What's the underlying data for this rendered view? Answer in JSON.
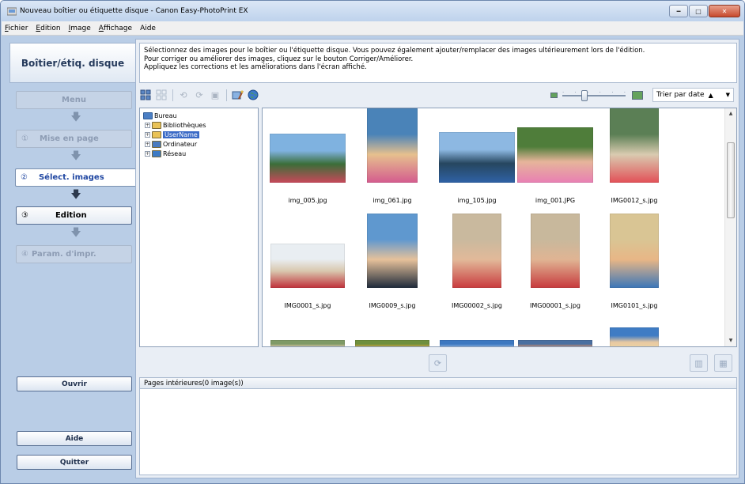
{
  "window": {
    "title": "Nouveau boîtier ou étiquette disque - Canon Easy-PhotoPrint EX"
  },
  "menu": [
    {
      "pre": "",
      "key": "F",
      "post": "ichier"
    },
    {
      "pre": "",
      "key": "E",
      "post": "dition"
    },
    {
      "pre": "",
      "key": "I",
      "post": "mage"
    },
    {
      "pre": "",
      "key": "A",
      "post": "ffichage"
    },
    {
      "pre": "",
      "key": "",
      "post": "Aide"
    }
  ],
  "sidebar": {
    "mode_title": "Boîtier/étiq. disque",
    "menu_step": "Menu",
    "steps": [
      {
        "num": "①",
        "label": "Mise en page",
        "state": "disabled"
      },
      {
        "num": "②",
        "label": "Sélect. images",
        "state": "active"
      },
      {
        "num": "③",
        "label": "Edition",
        "state": "enabled"
      },
      {
        "num": "④",
        "label": "Param. d'impr.",
        "state": "disabled"
      }
    ],
    "open_button": "Ouvrir",
    "help_button": "Aide",
    "quit_button": "Quitter"
  },
  "guide": {
    "lines": [
      "Sélectionnez des images pour le boîtier ou l'étiquette disque. Vous pouvez également ajouter/remplacer des images ultérieurement lors de l'édition.",
      "Pour corriger ou améliorer des images, cliquez sur le bouton Corriger/Améliorer.",
      "Appliquez les corrections et les améliorations dans l'écran affiché."
    ]
  },
  "toolbar": {
    "sort_label": "Trier par date",
    "sort_chevron": "▲"
  },
  "tree": {
    "root": "Bureau",
    "items": [
      {
        "label": "Bibliothèques",
        "color": "#e9c257"
      },
      {
        "label": "UserName",
        "color": "#e9c257",
        "selected": true
      },
      {
        "label": "Ordinateur",
        "color": "#4a7bc0"
      },
      {
        "label": "Réseau",
        "color": "#3d7ac4"
      }
    ]
  },
  "gallery": {
    "items": [
      {
        "name": "img_005.jpg",
        "w": 96,
        "h": 62,
        "c1": "#7fb2e0",
        "c2": "#3b6e38",
        "c3": "#c8485a"
      },
      {
        "name": "img_061.jpg",
        "w": 64,
        "h": 94,
        "c1": "#4a83b8",
        "c2": "#e6c08e",
        "c3": "#d45b8e"
      },
      {
        "name": "img_105.jpg",
        "w": 96,
        "h": 64,
        "c1": "#8db8e2",
        "c2": "#26465f",
        "c3": "#2f62a6"
      },
      {
        "name": "img_001.JPG",
        "w": 96,
        "h": 70,
        "c1": "#4f7d3a",
        "c2": "#e6b59a",
        "c3": "#e87fb3"
      },
      {
        "name": "IMG0012_s.jpg",
        "w": 62,
        "h": 94,
        "c1": "#5b7f55",
        "c2": "#d9cbb0",
        "c3": "#e25057"
      },
      {
        "name": "IMG0001_s.jpg",
        "w": 94,
        "h": 56,
        "c1": "#e9eef2",
        "c2": "#d9c7ae",
        "c3": "#c0303a"
      },
      {
        "name": "IMG0009_s.jpg",
        "w": 64,
        "h": 94,
        "c1": "#5f98cf",
        "c2": "#e6c19a",
        "c3": "#1e2a3a"
      },
      {
        "name": "IMG00002_s.jpg",
        "w": 62,
        "h": 94,
        "c1": "#c9b99e",
        "c2": "#e2b999",
        "c3": "#c93b3e"
      },
      {
        "name": "IMG00001_s.jpg",
        "w": 62,
        "h": 94,
        "c1": "#c8b89c",
        "c2": "#e0b493",
        "c3": "#c73a3d"
      },
      {
        "name": "IMG0101_s.jpg",
        "w": 62,
        "h": 94,
        "c1": "#d9c594",
        "c2": "#e8b686",
        "c3": "#3b76b8"
      },
      {
        "name": "",
        "w": 94,
        "h": 14,
        "c1": "#7f9a66",
        "c2": "#d9c6a2",
        "c3": "#e5e5e5"
      },
      {
        "name": "",
        "w": 94,
        "h": 14,
        "c1": "#6f8f3d",
        "c2": "#c9a23a",
        "c3": "#9abf5c"
      },
      {
        "name": "",
        "w": 94,
        "h": 14,
        "c1": "#3d78c0",
        "c2": "#7ea8d9",
        "c3": "#2b5e9e"
      },
      {
        "name": "",
        "w": 94,
        "h": 14,
        "c1": "#4a6fa0",
        "c2": "#c98a6a",
        "c3": "#e0e0e0"
      },
      {
        "name": "",
        "w": 62,
        "h": 30,
        "c1": "#3f7cc4",
        "c2": "#e7c8a2",
        "c3": "#f0d9a0"
      }
    ]
  },
  "pages": {
    "label": "Pages intérieures(0 image(s))"
  }
}
